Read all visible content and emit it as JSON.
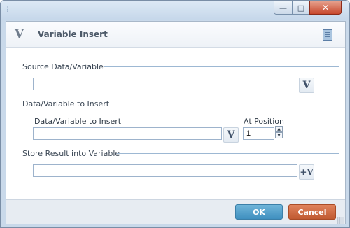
{
  "window": {
    "title": "",
    "controls": {
      "minimize": "—",
      "maximize": "□",
      "close": "✕"
    }
  },
  "header": {
    "logo": "V",
    "title": "Variable Insert",
    "help_icon": "note-icon"
  },
  "source_section": {
    "label": "Source Data/Variable",
    "input_value": "",
    "variable_button": "V"
  },
  "insert_section": {
    "label": "Data/Variable to Insert",
    "field_label": "Data/Variable to Insert",
    "input_value": "",
    "variable_button": "V",
    "position_label": "At Position",
    "position_value": "1",
    "spin_up": "▲",
    "spin_down": "▼"
  },
  "result_section": {
    "label": "Store Result into Variable",
    "input_value": "",
    "variable_button": "+V"
  },
  "footer": {
    "ok_label": "OK",
    "cancel_label": "Cancel"
  },
  "colors": {
    "ok_button": "#4a9acb",
    "cancel_button": "#cc6a3f",
    "section_rule": "#9db8d3"
  }
}
